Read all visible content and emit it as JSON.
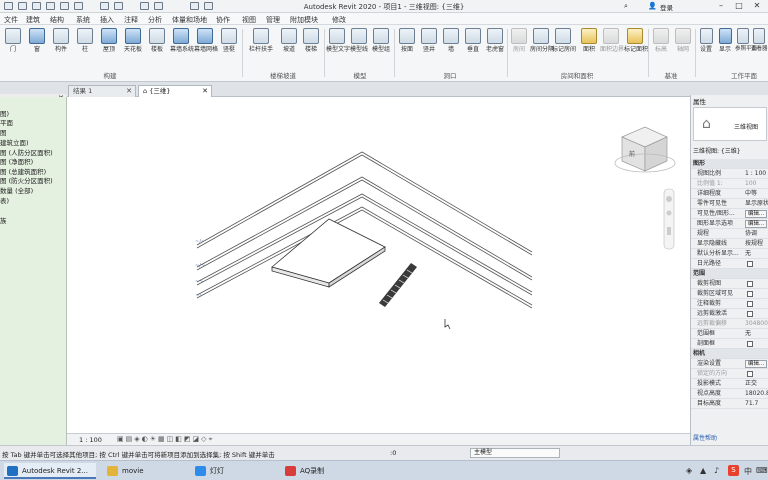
{
  "app": {
    "title": "Autodesk Revit 2020 - 项目1 - 三维视图: {三维}",
    "account": "登录"
  },
  "menu": [
    "文件",
    "建筑",
    "结构",
    "系统",
    "插入",
    "注释",
    "分析",
    "体量和场地",
    "协作",
    "视图",
    "管理",
    "附加模块",
    "修改"
  ],
  "ribbon": {
    "build": [
      "门",
      "窗",
      "构件",
      "柱",
      "屋顶",
      "天花板",
      "楼板",
      "幕墙系统",
      "幕墙网格",
      "竖梃"
    ],
    "circulation": [
      "栏杆扶手",
      "坡道",
      "楼梯"
    ],
    "model": [
      "模型文字",
      "模型线",
      "模型组"
    ],
    "opening": [
      "按面",
      "竖井",
      "墙",
      "垂直",
      "老虎窗"
    ],
    "room": [
      "房间",
      "房间分隔",
      "标记房间",
      "面积",
      "面积边界",
      "标记面积"
    ],
    "datum": [
      "标高",
      "轴网"
    ],
    "workplane": [
      "设置",
      "显示",
      "参照平面",
      "查看器"
    ],
    "panels": {
      "build": "构建",
      "circulation": "楼梯坡道",
      "model": "模型",
      "opening": "洞口",
      "room": "房间和面积",
      "datum": "基准",
      "workplane": "工作平面"
    }
  },
  "tabs": [
    {
      "label": "结果 1",
      "active": false
    },
    {
      "label": "{三维}",
      "active": true
    }
  ],
  "browser": {
    "header": "目3",
    "items": [
      "图)",
      "平面",
      "图",
      "建筑立面)",
      "图 (人防分区面积)",
      "图 (净面积)",
      "图 (总建筑面积)",
      "图 (防火分区面积)",
      "数量 (全部)",
      "表)",
      "族"
    ]
  },
  "viewbar": {
    "scale": "1 : 100"
  },
  "status": {
    "hint": "按 Tab 键并单击可选择其他项目; 按 Ctrl 键并单击可将新项目添加到选择集; 按 Shift 键并单击",
    "model": "主模型",
    "count": ":0"
  },
  "properties": {
    "header": "属性",
    "type_name": "三维视图",
    "selector": "三维视图: {三维}",
    "edit_type": "编辑",
    "rows": [
      {
        "kind": "cat",
        "k": "图形"
      },
      {
        "k": "视图比例",
        "v": "1 : 100"
      },
      {
        "k": "比例值 1:",
        "v": "100",
        "dim": true
      },
      {
        "k": "详细程度",
        "v": "中等"
      },
      {
        "k": "零件可见性",
        "v": "显示原状"
      },
      {
        "k": "可见性/图形...",
        "v": "编辑..."
      },
      {
        "k": "图形显示选项",
        "v": "编辑..."
      },
      {
        "k": "规程",
        "v": "协调"
      },
      {
        "k": "显示隐藏线",
        "v": "按规程"
      },
      {
        "k": "默认分析显示...",
        "v": "无"
      },
      {
        "k": "日光路径",
        "check": true
      },
      {
        "kind": "cat",
        "k": "范围"
      },
      {
        "k": "裁剪视图",
        "check": true
      },
      {
        "k": "裁剪区域可见",
        "check": true
      },
      {
        "k": "注释裁剪",
        "check": true
      },
      {
        "k": "远剪裁激活",
        "check": true
      },
      {
        "k": "远剪裁偏移",
        "v": "304800",
        "dim": true
      },
      {
        "k": "范围框",
        "v": "无"
      },
      {
        "k": "剖面框",
        "check": true
      },
      {
        "kind": "cat",
        "k": "相机"
      },
      {
        "k": "渲染设置",
        "v": "编辑..."
      },
      {
        "k": "锁定的方向",
        "check": true,
        "dim": true
      },
      {
        "k": "投影模式",
        "v": "正交"
      },
      {
        "k": "视点高度",
        "v": "18020.8"
      },
      {
        "k": "目标高度",
        "v": "71.7"
      }
    ],
    "help": "属性帮助"
  },
  "taskbar": {
    "items": [
      "Autodesk Revit 2...",
      "movie",
      "灯灯",
      "AQ录制"
    ],
    "ime": "中"
  },
  "viewcube": {
    "label": "前"
  },
  "colors": {
    "browser_bg": "#e4f0e0",
    "accent": "#4a78b8"
  }
}
